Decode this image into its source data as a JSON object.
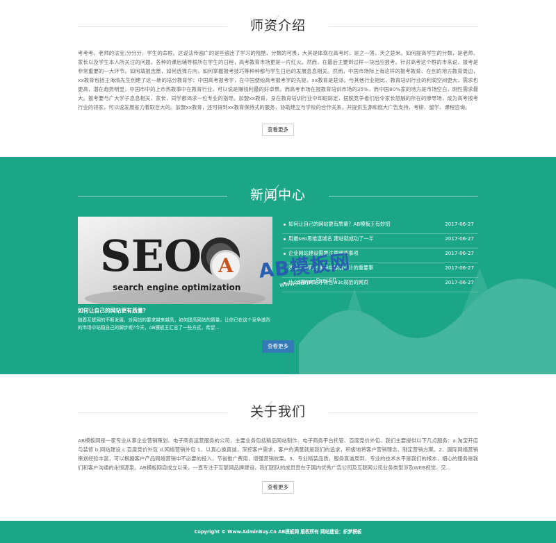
{
  "teachers": {
    "title": "师资介绍",
    "text": "考考考，老师的法宝;分分分，学生的命根。这说法传遍广的是些遍出了学习的残酷，分数的可畏，大其是体现在高考时，是之一落，天之楚米。如何提高学生的分数，是老师、家长以及学生本人所关注的问题。各种的课后辅导根所在学生的日程，高考教育市场更是一片红火。然而，在最后主要到过样一块出应报考。针对高考这个群的市来说，报考是非常重要的一大环节。如何填报志愿，如何选择方向，如何掌握报考技巧等种种都与学生日后的发展息息相关。然而，中国市场际上有这样的报考教育、在创的地方教育周边，xx教育包括王海清先生创建了这一新的培分教育学：中国高考报考学，在中国便纷高考报考学的先驱，xx教育是楚派。与其他行业相比，教育培训行业的利润空间更大，需求也更高，潜在趋势明显，中国市中的上市热教事中在教育行业，可以说是赚钱利最的好卓景。而高考市场在报教育培训市场的35%，而中国80%家的地方是市场空白，刚性需求最大。报考要与广大学子息息相关，家长，同学都渴求一位专业的指导。加盟xx教育，身在教育培训行业中却蹈踪定，摆脱竞争者们后令家长怒触的所在的惨导场，成为高考报考行业的领家，可以说发展省力着取巨大的。加盟xx教育，还可得到xx教育保持式的服务，协助建立与学校的合作关系，并提供生源和庞大广告支持，考研、留学、课程咨询。",
    "more_label": "查看更多"
  },
  "news": {
    "title": "新闻中心",
    "feature": {
      "title": "如何让自己的网站更有质量？",
      "desc": "随着互联网的不断发展，对网站的要求越来越高，如何提高网站的质量，让你已在这个竞争激烈的市场中站稳自己的脚步呢?今天，AB模板王汇总了一些方式，希望..."
    },
    "items": [
      {
        "title": "如何让自己的网站更有质量？AB模板王有妙招",
        "date": "2017-06-27"
      },
      {
        "title": "用最seo思维选城名 建站就成功了一半",
        "date": "2017-06-27"
      },
      {
        "title": "企业网站建设需要注意哪些事项",
        "date": "2017-06-27"
      },
      {
        "title": "浅谈企业网站建设中导航设计的重要事",
        "date": "2017-06-27"
      },
      {
        "title": "什么样的网站才符合w3c规范的网页",
        "date": "2017-06-27"
      }
    ],
    "more_label": "查看更多",
    "watermark": {
      "brand": "AB模板网",
      "url": "www.AdminBuy.cn",
      "letter": "A"
    },
    "seo_img": {
      "big": "SEO",
      "tag": "search engine optimization"
    }
  },
  "about": {
    "title": "关于我们",
    "text": "AB模板网是一家专业从事企业营销策划、电子商务运营服务的公司，主要业务包括精品网站制作、电子商务平台托管、百度竞价外包、我们主要提供以下几点服务：a.淘宝开店与装修 b.网站建设 c.百度竞价外包 d.网络营销外包 1、以真心换真诚，深挖客户需求，客户的满意就是我们的追求，积极地将客户营销理念、制定营销方案。2、国际网络营销策划经验丰富，可以根据客户产品网络营销中不必要的投入，节省推广费用，增强营销效果。3、专业精装品质，服务真诚周到，专业的技术水平是我们的根本，细心的服务是我们和客户沟通的永恒源泉。AB模板网自成立以来，一直专注于互联网品牌建设，我们团队的成员曾在于国内优秀广告公司及互联网公司业务类型涉及WEB视觉、交...",
    "more_label": "查看更多"
  },
  "footer": {
    "text": "Copyright © Www.AdminBuy.Cn AB模板网 版权所有  网站建设：织梦模板"
  }
}
